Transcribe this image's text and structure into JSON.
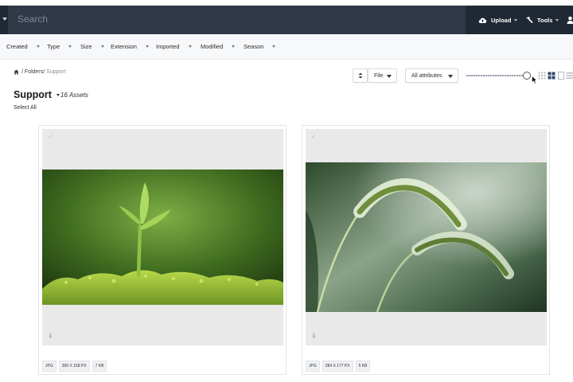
{
  "header": {
    "search_placeholder": "Search",
    "upload_label": "Upload",
    "tools_label": "Tools"
  },
  "filters": [
    "Created",
    "Type",
    "Size",
    "Extension",
    "Imported",
    "Modified",
    "Season"
  ],
  "breadcrumb": {
    "folders": "Folders/",
    "current": "Support",
    "separator": "/"
  },
  "toolbar": {
    "sort_icon": "sort-icon",
    "file_select": "File",
    "attributes_select": "All attributes",
    "zoom_level": 0.93
  },
  "page": {
    "title": "Support",
    "asset_count": "16 Assets",
    "select_all": "Select All"
  },
  "cards": [
    {
      "ext": "JPG",
      "dims": "300 X 168 PX",
      "size": "7 KB",
      "image": "seedling sprout on moss"
    },
    {
      "ext": "JPG",
      "dims": "284 X 177 PX",
      "size": "5 KB",
      "image": "foxtail grass stalks"
    }
  ],
  "colors": {
    "header_bg": "#2f3947",
    "header_dark": "#1f2833",
    "filterbar_bg": "#f7f8fa",
    "card_bg": "#e9e9e9"
  }
}
